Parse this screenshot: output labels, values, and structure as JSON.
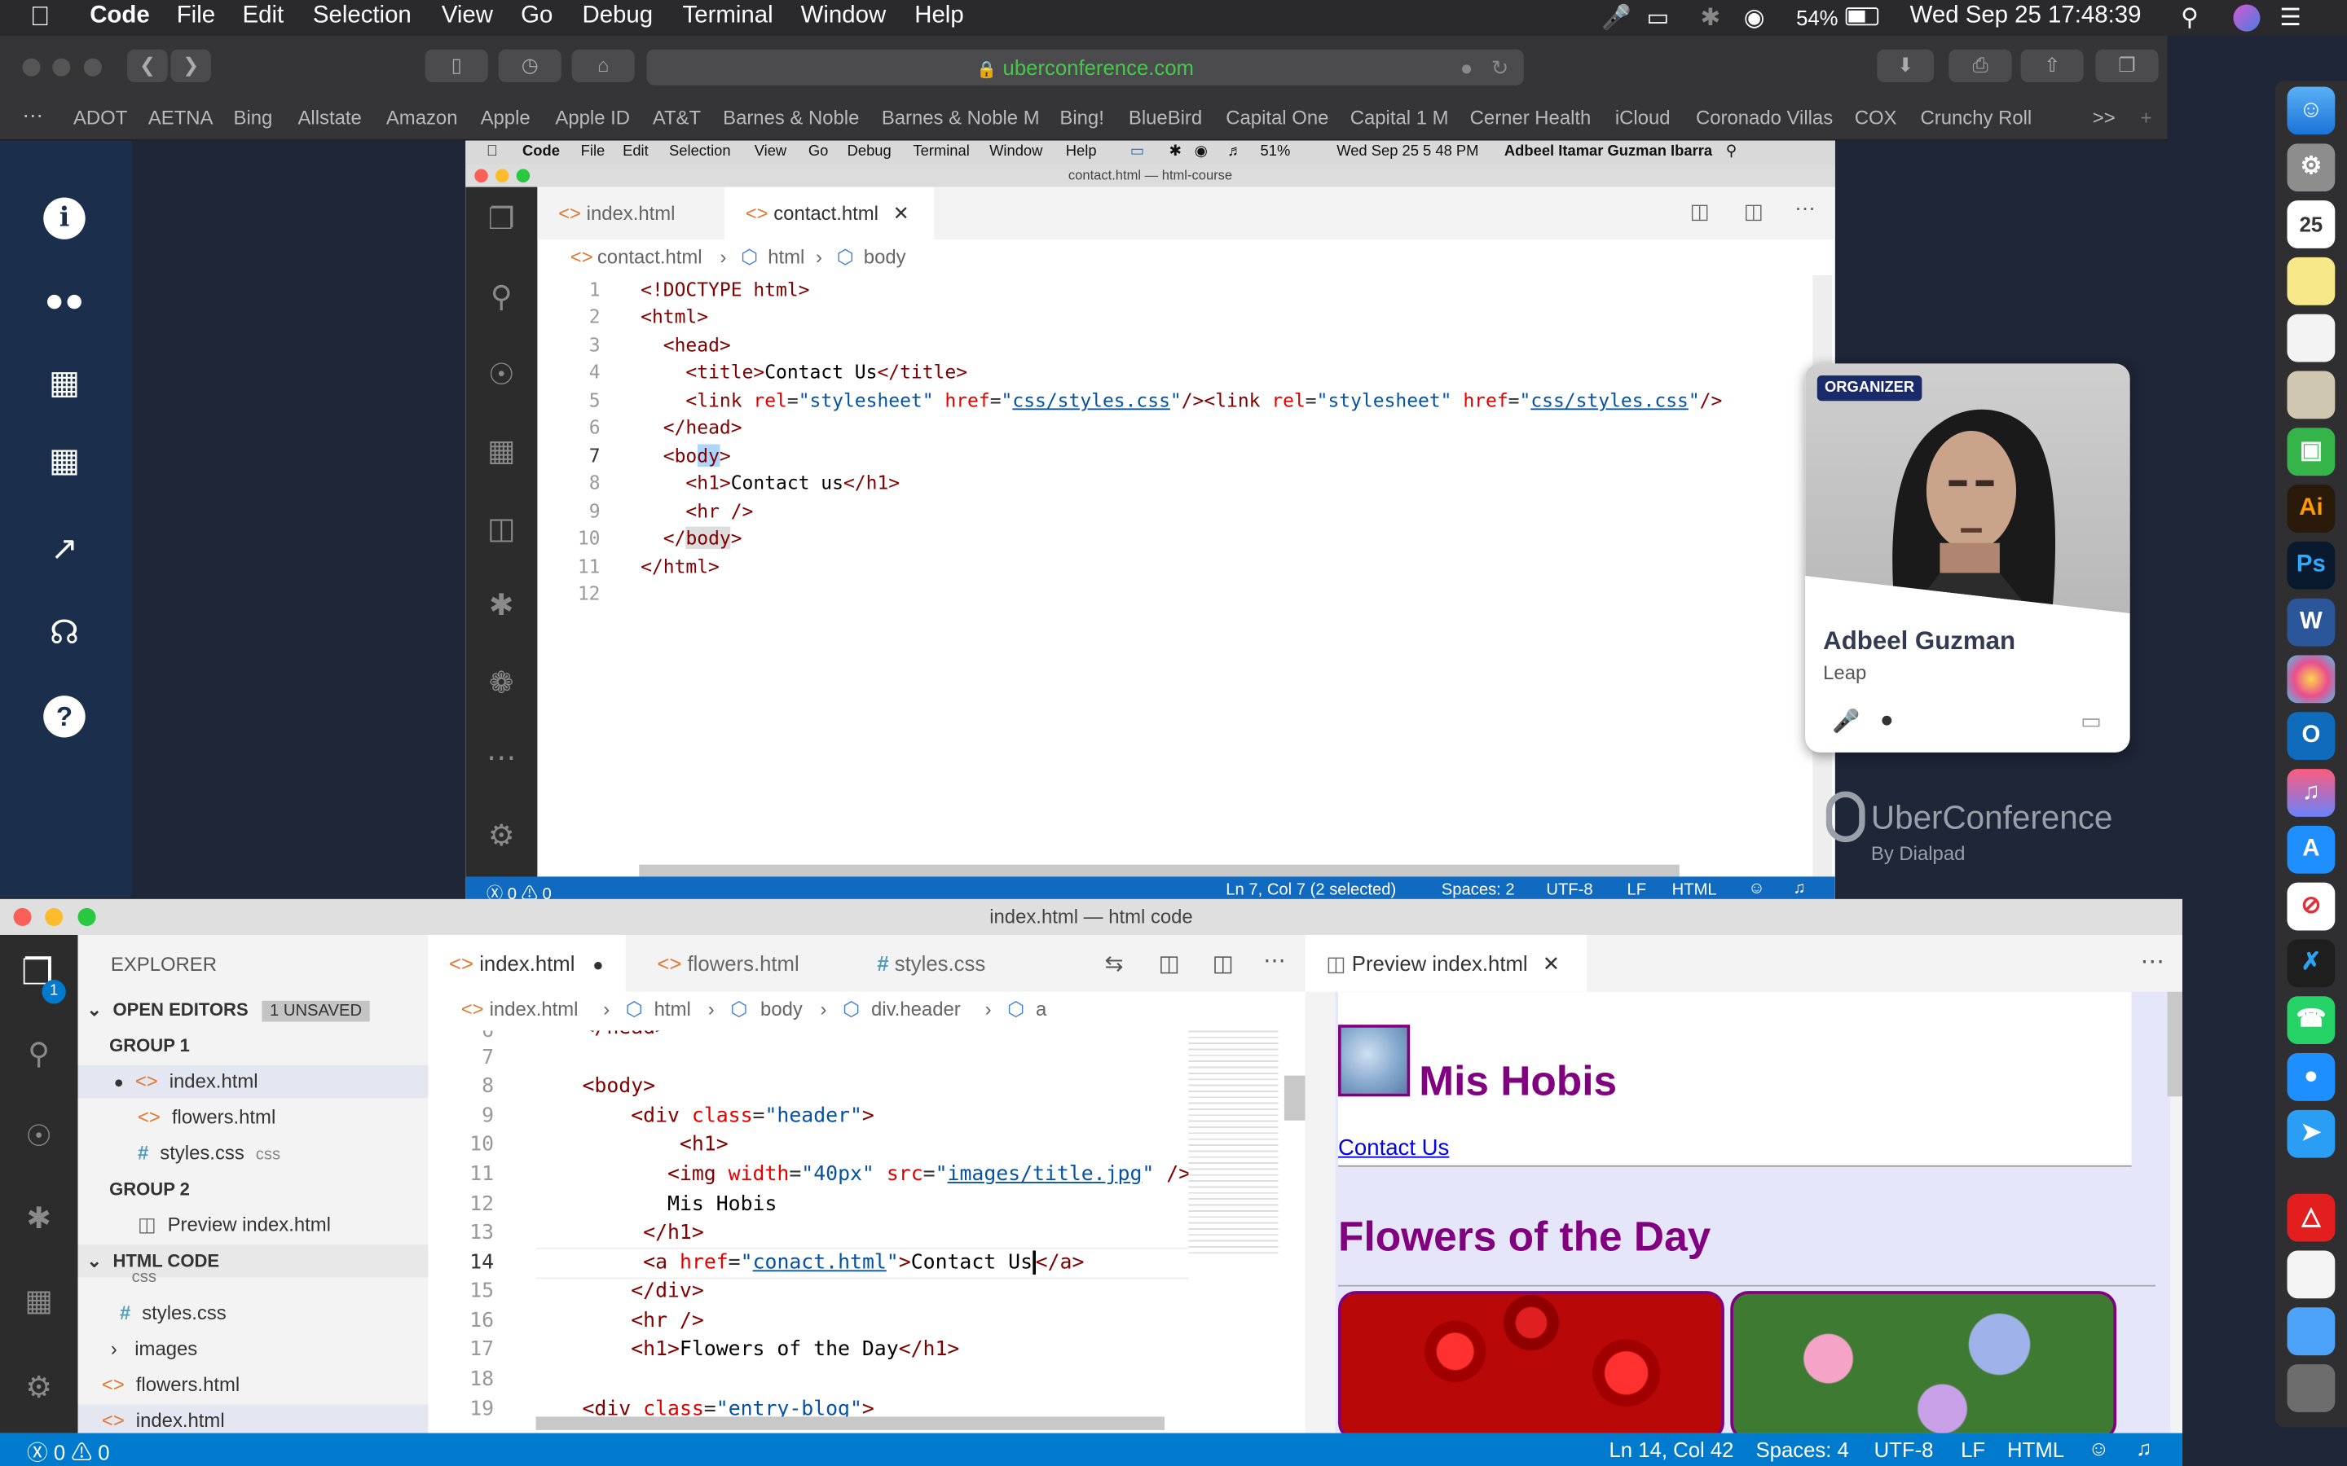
{
  "mac": {
    "app": "Code",
    "menus": [
      "File",
      "Edit",
      "Selection",
      "View",
      "Go",
      "Debug",
      "Terminal",
      "Window",
      "Help"
    ],
    "battery": "54%",
    "datetime": "Wed Sep 25  17:48:39"
  },
  "safari": {
    "url": "uberconference.com",
    "favorites": [
      "ADOT",
      "AETNA",
      "Bing",
      "Allstate",
      "Amazon",
      "Apple",
      "Apple ID",
      "AT&T",
      "Barnes & Noble",
      "Barnes & Noble M",
      "Bing!",
      "BlueBird",
      "Capital One",
      "Capital 1 M",
      "Cerner Health",
      "iCloud",
      "Coronado Villas",
      "COX",
      "Crunchy Roll"
    ],
    "more": ">>",
    "add": "+"
  },
  "inner": {
    "mac": {
      "app": "Code",
      "menus": [
        "File",
        "Edit",
        "Selection",
        "View",
        "Go",
        "Debug",
        "Terminal",
        "Window",
        "Help"
      ],
      "battery": "51%",
      "datetime": "Wed Sep 25  5 48 PM",
      "user": "Adbeel Itamar Guzman Ibarra"
    },
    "title": "contact.html — html-course",
    "tabs": [
      "index.html",
      "contact.html"
    ],
    "crumbs": [
      "contact.html",
      "html",
      "body"
    ],
    "status": {
      "errors": "0",
      "warnings": "0",
      "position": "Ln 7, Col 7 (2 selected)",
      "spaces": "Spaces: 2",
      "encoding": "UTF-8",
      "eol": "LF",
      "language": "HTML"
    }
  },
  "card": {
    "badge": "ORGANIZER",
    "name": "Adbeel Guzman",
    "subtitle": "Leap"
  },
  "uberLogo": {
    "name": "UberConference",
    "by": "By Dialpad"
  },
  "vs": {
    "title": "index.html — html code",
    "explorer": "EXPLORER",
    "openEditors": "OPEN EDITORS",
    "unsaved": "1 UNSAVED",
    "group1": "GROUP 1",
    "group2": "GROUP 2",
    "openFiles": [
      "index.html",
      "flowers.html",
      "styles.css"
    ],
    "cssHint": "css",
    "previewFile": "Preview index.html",
    "project": "HTML CODE",
    "tree": [
      "css",
      "styles.css",
      "images",
      "flowers.html",
      "index.html"
    ],
    "badgeCount": "1",
    "tabs": [
      "index.html",
      "flowers.html",
      "styles.css"
    ],
    "crumbs": [
      "index.html",
      "html",
      "body",
      "div.header",
      "a"
    ],
    "previewTab": "Preview index.html",
    "status": {
      "errors": "0",
      "warnings": "0",
      "position": "Ln 14, Col 42",
      "spaces": "Spaces: 4",
      "encoding": "UTF-8",
      "eol": "LF",
      "language": "HTML"
    }
  },
  "preview": {
    "siteTitle": "Mis Hobis",
    "link": "Contact Us",
    "heading": "Flowers of the Day"
  },
  "colors": {
    "accent": "#007acc",
    "purple": "#800080",
    "previewBg": "#e6e6fa"
  }
}
